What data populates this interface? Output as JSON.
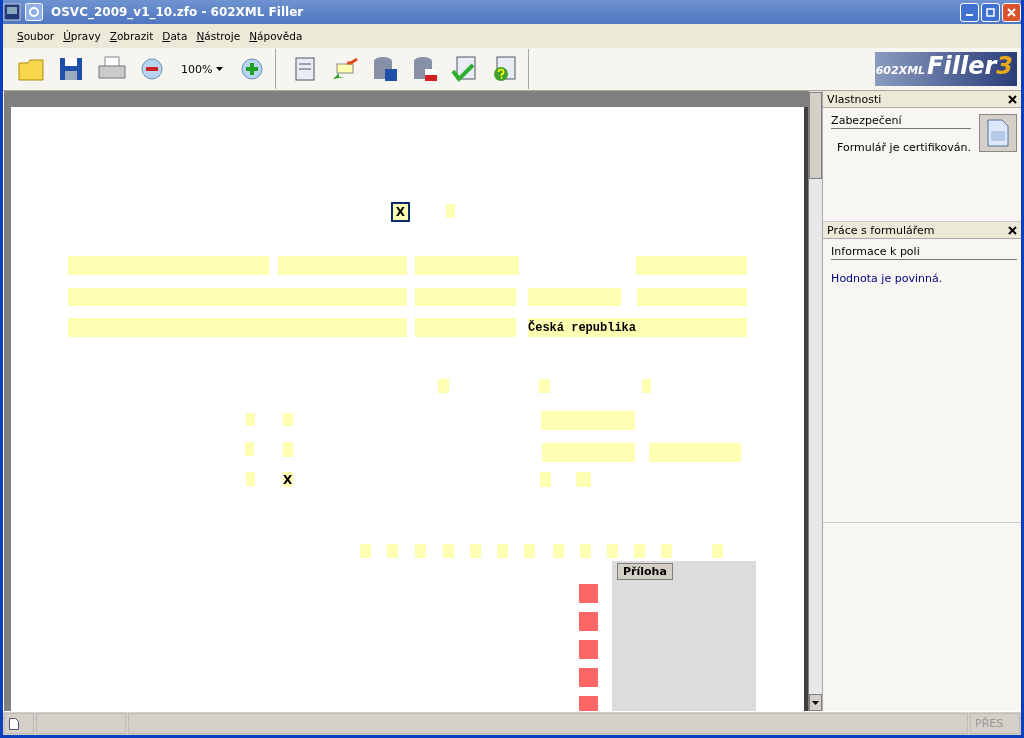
{
  "window": {
    "title": "OSVC_2009_v1_10.zfo - 602XML Filler"
  },
  "menu_items": [
    "Soubor",
    "Úpravy",
    "Zobrazit",
    "Data",
    "Nástroje",
    "Nápověda"
  ],
  "toolbar": {
    "zoom": "100%"
  },
  "logo": {
    "prefix": "602XML",
    "name": "Filler",
    "version": "3"
  },
  "form": {
    "checkboxes": [
      {
        "mark": "X",
        "checked": true
      },
      {
        "mark": "X",
        "checked": true
      }
    ],
    "country": "Česká republika",
    "attachment_button": "Příloha"
  },
  "panels": [
    {
      "title": "Vlastnosti",
      "section": "Zabezpečení",
      "text": "Formulář je certifikován.",
      "kind": "info"
    },
    {
      "title": "Práce s formulářem",
      "section": "Informace k poli",
      "text": "Hodnota je povinná.",
      "kind": "hint"
    }
  ],
  "status_bar": {
    "mode": "PŘES"
  }
}
